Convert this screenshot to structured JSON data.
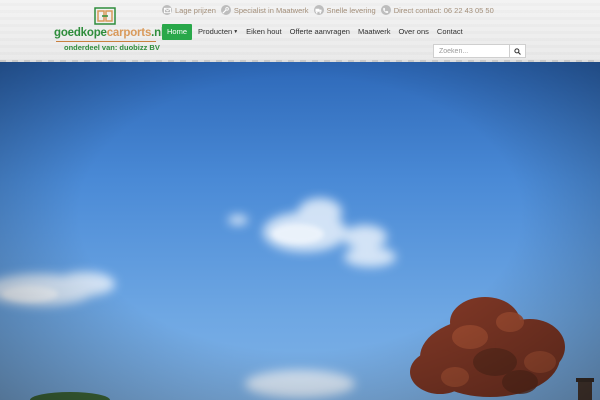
{
  "logo": {
    "part1": "goedkope",
    "part2": "carports",
    "part3": ".nl",
    "subtitle": "onderdeel van: duobizz BV"
  },
  "usps": [
    {
      "icon": "envelope-icon",
      "label": "Lage prijzen"
    },
    {
      "icon": "wrench-icon",
      "label": "Specialist in Maatwerk"
    },
    {
      "icon": "truck-icon",
      "label": "Snelle levering"
    },
    {
      "icon": "phone-icon",
      "label": "Direct contact: 06 22 43 05 50"
    }
  ],
  "nav": {
    "items": [
      {
        "label": "Home",
        "active": true
      },
      {
        "label": "Producten",
        "dropdown": true
      },
      {
        "label": "Eiken hout"
      },
      {
        "label": "Offerte aanvragen"
      },
      {
        "label": "Maatwerk"
      },
      {
        "label": "Over ons"
      },
      {
        "label": "Contact"
      }
    ]
  },
  "search": {
    "placeholder": "Zoeken..."
  },
  "colors": {
    "accent": "#29a84a",
    "brand_green": "#2f8d3c",
    "brand_orange": "#d99a5b",
    "sky": "#4a8ad6"
  }
}
